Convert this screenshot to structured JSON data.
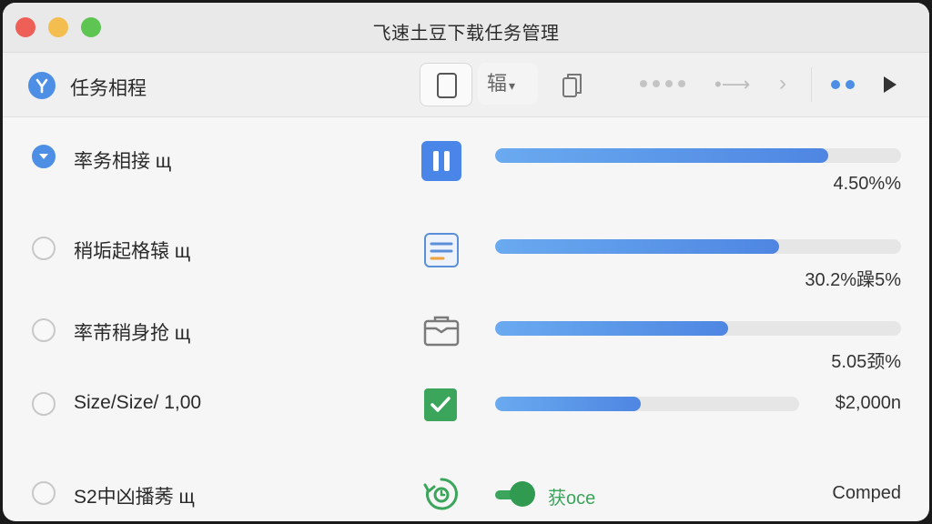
{
  "window": {
    "title": "飞速土豆下载任务管理"
  },
  "toolbar": {
    "title": "任务相程",
    "select_label": "辐",
    "select_caret": "▾",
    "arrow": "•⟶",
    "chevron": "›"
  },
  "tasks": [
    {
      "name": "率务相接 щ",
      "status": "paused",
      "progress": 0.82,
      "value": "4.50%%",
      "selected": true
    },
    {
      "name": "稍垢起格辕 щ",
      "status": "document",
      "progress": 0.7,
      "value": "30.2%躁5%",
      "selected": false
    },
    {
      "name": "率芾稍身抢 щ",
      "status": "package",
      "progress": 0.575,
      "value": "5.05颈%",
      "selected": false
    },
    {
      "name": "Size/Size/ 1,00",
      "status": "done",
      "progress": 0.48,
      "value": "$2,000n",
      "selected": false
    },
    {
      "name": "S2中凶播莠 щ",
      "status": "syncing",
      "toggle_label": "获oce",
      "value": "Comped",
      "selected": false
    }
  ],
  "colors": {
    "accent": "#4e8fe6",
    "success": "#3aa55b"
  }
}
